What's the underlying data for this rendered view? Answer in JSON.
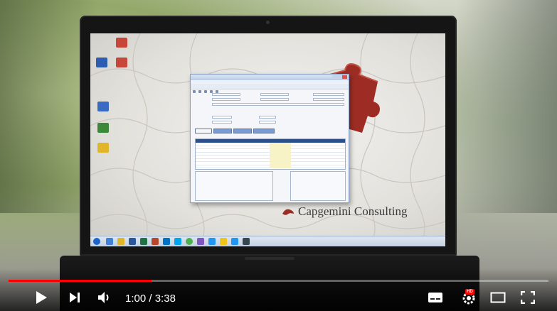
{
  "video": {
    "progress_fraction": 0.265,
    "current_time": "1:00",
    "separator": " / ",
    "duration": "3:38"
  },
  "controls": {
    "play_icon": "play-icon",
    "next_icon": "next-icon",
    "volume_icon": "volume-icon",
    "subtitles_icon": "subtitles-icon",
    "settings_icon": "settings-icon",
    "settings_badge": "HD",
    "theater_icon": "theater-mode-icon",
    "fullscreen_icon": "fullscreen-icon"
  },
  "screen": {
    "brand_name": "Capgemini Consulting"
  },
  "colors": {
    "progress": "#ff0000",
    "app_tab_blue": "#7a9bd2",
    "puzzle_red": "#9d2d24"
  }
}
